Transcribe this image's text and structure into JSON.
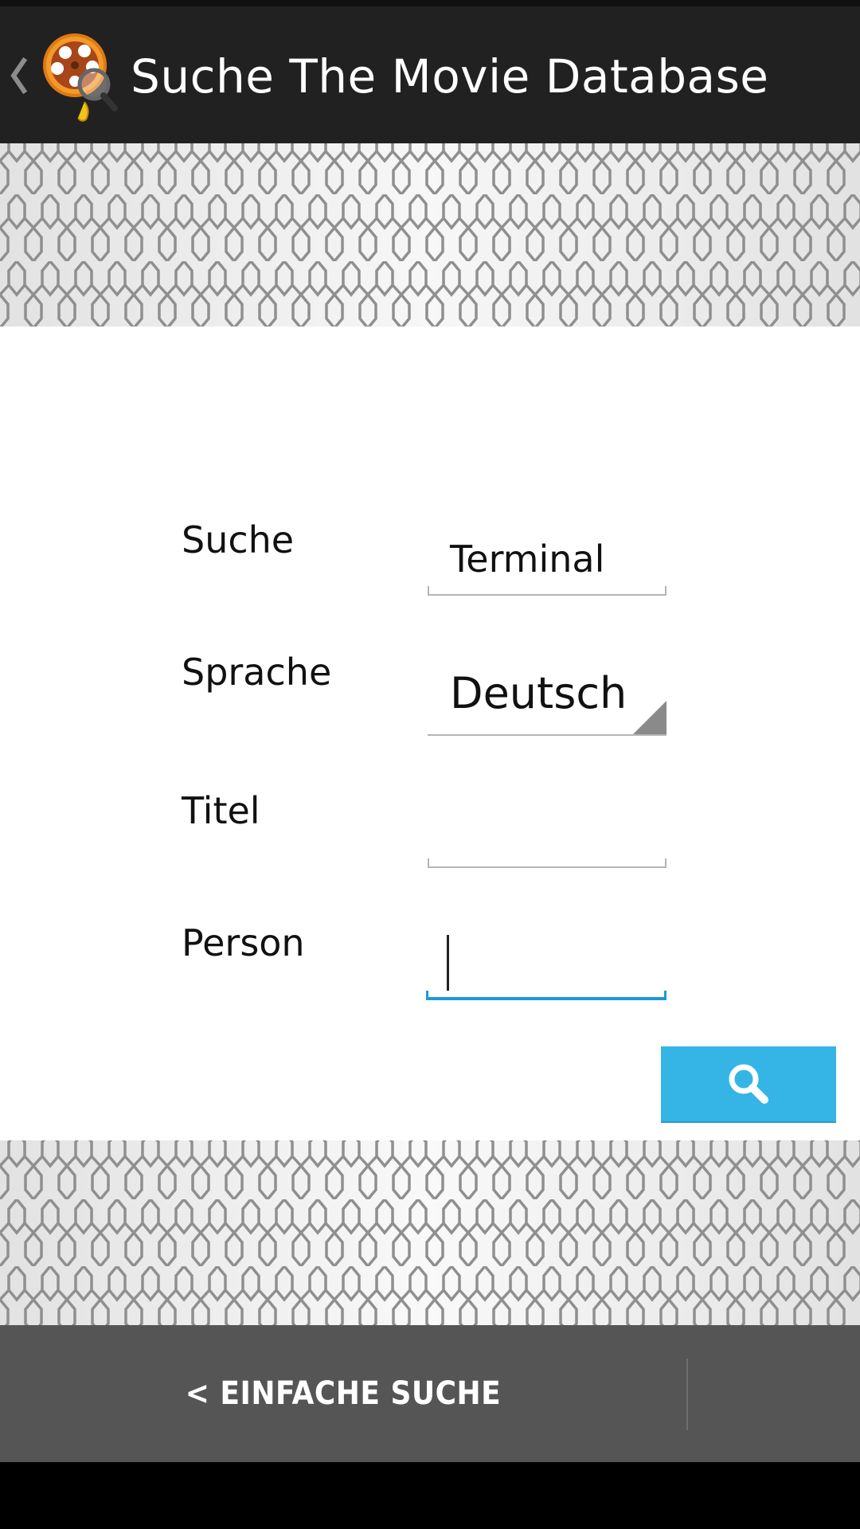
{
  "action_bar": {
    "title": "Suche The Movie Database",
    "logo_icon": "film-reel-magnifier-icon",
    "up_icon": "up-caret-icon"
  },
  "form": {
    "search_label": "Suche",
    "search_value": "Terminal",
    "language_label": "Sprache",
    "language_value": "Deutsch",
    "title_label": "Titel",
    "title_value": "",
    "person_label": "Person",
    "person_value": ""
  },
  "search_button": {
    "icon": "search-icon",
    "color": "#35B5E5"
  },
  "bottom_bar": {
    "simple_search_label": "< EINFACHE SUCHE"
  },
  "colors": {
    "action_bar": "#212121",
    "bottom_bar": "#555555",
    "focus_underline": "#1A9AD6"
  }
}
